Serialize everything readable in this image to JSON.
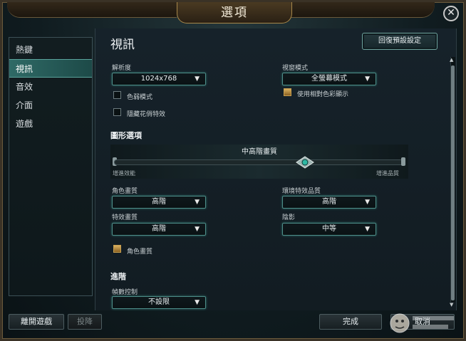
{
  "window": {
    "title": "選項"
  },
  "sidebar": {
    "items": [
      {
        "label": "熱鍵",
        "active": false
      },
      {
        "label": "視訊",
        "active": true
      },
      {
        "label": "音效",
        "active": false
      },
      {
        "label": "介面",
        "active": false
      },
      {
        "label": "遊戲",
        "active": false
      }
    ]
  },
  "header": {
    "title": "視訊",
    "reset_label": "回復預設設定"
  },
  "video": {
    "resolution_label": "解析度",
    "resolution_value": "1024x768",
    "window_mode_label": "視窗模式",
    "window_mode_value": "全螢幕模式",
    "colorblind_label": "色弱模式",
    "colorblind_checked": false,
    "hide_flair_label": "隱藏花俏特效",
    "hide_flair_checked": false,
    "relative_color_label": "使用相對色彩顯示",
    "relative_color_checked": true
  },
  "graphics": {
    "section_label": "圖形選項",
    "quality_value": "中高階畫質",
    "slider_min_label": "增進效能",
    "slider_max_label": "增進品質",
    "slider_level": 0.66,
    "character_quality_label": "角色畫質",
    "character_quality_value": "高階",
    "environment_quality_label": "環境特效品質",
    "environment_quality_value": "高階",
    "effects_quality_label": "特效畫質",
    "effects_quality_value": "高階",
    "shadows_label": "陰影",
    "shadows_value": "中等",
    "character_ink_label": "角色畫質",
    "character_ink_checked": true
  },
  "advanced": {
    "section_label": "進階",
    "fps_label": "幀數控制",
    "fps_value": "不設限"
  },
  "footer": {
    "exit_label": "離開遊戲",
    "surrender_label": "投降",
    "done_label": "完成",
    "cancel_label": "取消"
  },
  "colors": {
    "accent_teal": "#4e8e89",
    "active_tab": "#2f6a66",
    "gold_check": "#c8a050"
  }
}
